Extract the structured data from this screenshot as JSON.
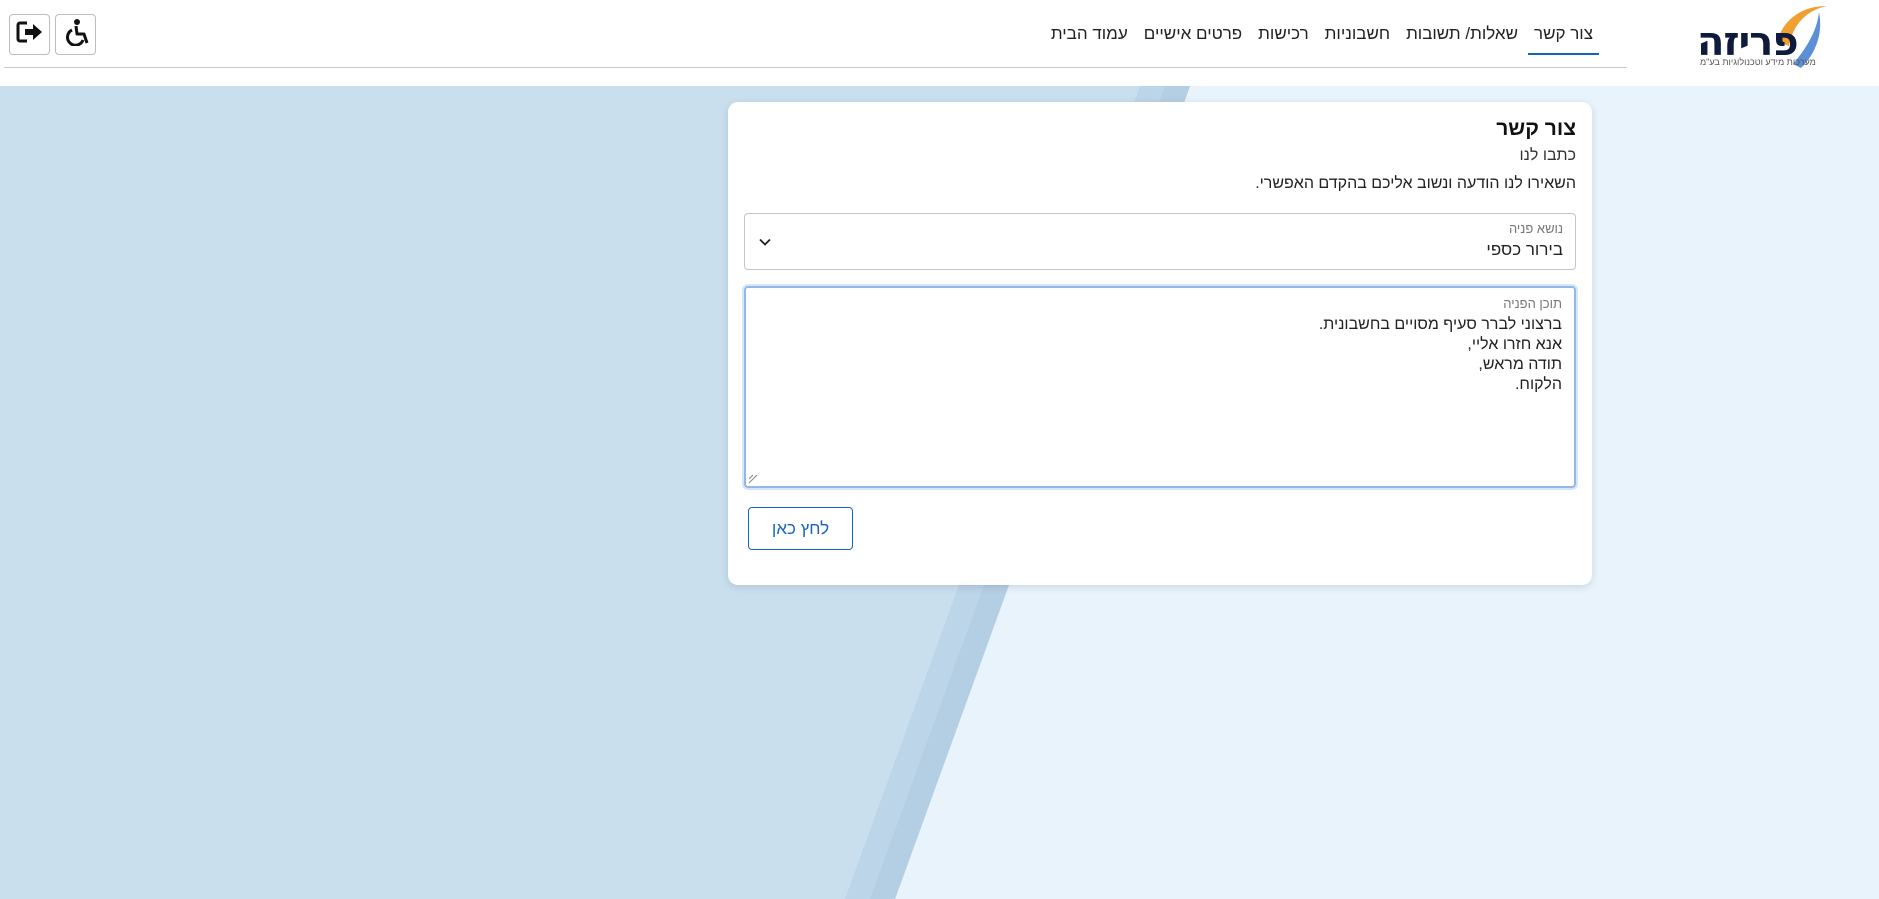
{
  "brand": {
    "logo_text": "פריזה",
    "logo_subtitle": "מערכות מידע וטכנולוגיות בע\"מ",
    "colors": {
      "navy": "#0f1b3d",
      "orange": "#f0a030",
      "blue": "#5b8fd6"
    }
  },
  "header": {
    "nav": [
      {
        "label": "עמוד הבית",
        "active": false
      },
      {
        "label": "פרטים אישיים",
        "active": false
      },
      {
        "label": "רכישות",
        "active": false
      },
      {
        "label": "חשבוניות",
        "active": false
      },
      {
        "label": "שאלות/ תשובות",
        "active": false
      },
      {
        "label": "צור קשר",
        "active": true
      }
    ],
    "accessibility_icon": "wheelchair-icon",
    "logout_icon": "sign-out-icon"
  },
  "form": {
    "title": "צור קשר",
    "subtitle": "כתבו לנו",
    "description": "השאירו לנו הודעה ונשוב אליכם בהקדם האפשרי.",
    "subject": {
      "label": "נושא פניה",
      "value": "בירור כספי"
    },
    "content": {
      "label": "תוכן הפניה",
      "lines": [
        "ברצוני לברר סעיף מסויים בחשבונית.",
        "אנא חזרו אליי,",
        "תודה מראש,",
        "הלקוח."
      ]
    },
    "submit_label": "לחץ כאן"
  },
  "colors": {
    "accent": "#1565c0",
    "page_background": "#e8f3fc",
    "panel_background": "#cbe1f0",
    "focus_border": "#90b8e8"
  }
}
